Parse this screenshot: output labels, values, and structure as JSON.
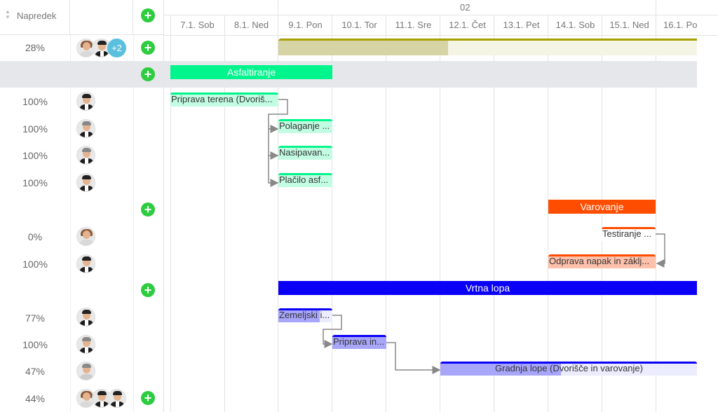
{
  "header": {
    "progress_label": "Napredek",
    "week_label": "02",
    "days": [
      "7.1. Sob",
      "8.1. Ned",
      "9.1. Pon",
      "10.1. Tor",
      "11.1. Sre",
      "12.1. Čet",
      "13.1. Pet",
      "14.1. Sob",
      "15.1. Ned",
      "16.1. Po"
    ]
  },
  "rows": [
    {
      "progress": "28%",
      "extra_count": "+2"
    },
    {
      "progress": ""
    },
    {
      "progress": "100%"
    },
    {
      "progress": "100%"
    },
    {
      "progress": "100%"
    },
    {
      "progress": "100%"
    },
    {
      "progress": ""
    },
    {
      "progress": "0%"
    },
    {
      "progress": "100%"
    },
    {
      "progress": ""
    },
    {
      "progress": "77%"
    },
    {
      "progress": "100%"
    },
    {
      "progress": "47%"
    },
    {
      "progress": "44%"
    }
  ],
  "groups": {
    "asfaltiranje": "Asfaltiranje",
    "varovanje": "Varovanje",
    "vrtna_lopa": "Vrtna lopa"
  },
  "tasks": {
    "priprava_terena": "Priprava terena (Dvoriš...",
    "polaganje": "Polaganje ...",
    "nasipavan": "Nasipavan...",
    "placilo": "Plačilo asf...",
    "testiranje": "Testiranje ...",
    "odprava": "Odprava napak in záklj...",
    "zemeljski": "Zemeljski i...",
    "priprava_in": "Priprava in...",
    "gradnja": "Gradnja lope (Dvorišče in varovanje)"
  },
  "project_progress": 0.28,
  "task_progress": {
    "zemeljski": 0.77,
    "gradnja": 0.47
  },
  "colors": {
    "asfaltiranje": "#00f58c",
    "varovanje": "#ff4d00",
    "vrtna_lopa": "#0a00f5",
    "project": "#a6a000",
    "plus": "#2ecc40"
  }
}
